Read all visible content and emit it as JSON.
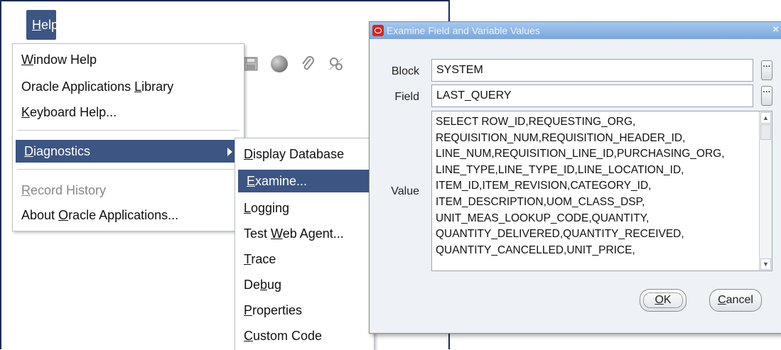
{
  "menubar": {
    "help": {
      "hotkey": "H",
      "rest": "elp"
    }
  },
  "help_menu": {
    "items": [
      {
        "hotkey": "W",
        "rest": "indow Help",
        "pre": ""
      },
      {
        "pre": "Oracle Applications ",
        "hotkey": "L",
        "rest": "ibrary"
      },
      {
        "pre": "",
        "hotkey": "K",
        "rest": "eyboard Help..."
      },
      {
        "pre": "",
        "hotkey": "D",
        "rest": "iagnostics"
      },
      {
        "pre": "",
        "hotkey": "R",
        "rest": "ecord History"
      },
      {
        "pre": "About ",
        "hotkey": "O",
        "rest": "racle Applications..."
      }
    ]
  },
  "diagnostics_menu": {
    "items": [
      {
        "pre": "",
        "hotkey": "D",
        "rest": "isplay Database"
      },
      {
        "pre": "",
        "hotkey": "E",
        "rest": "xamine..."
      },
      {
        "pre": "",
        "hotkey": "L",
        "rest": "ogging"
      },
      {
        "pre": "Test ",
        "hotkey": "W",
        "rest": "eb Agent..."
      },
      {
        "pre": "",
        "hotkey": "T",
        "rest": "race"
      },
      {
        "pre": "De",
        "hotkey": "b",
        "rest": "ug"
      },
      {
        "pre": "",
        "hotkey": "P",
        "rest": "roperties"
      },
      {
        "pre": "",
        "hotkey": "C",
        "rest": "ustom Code"
      }
    ]
  },
  "dialog": {
    "title": "Examine Field and Variable Values",
    "close": "×",
    "block_label": "Block",
    "block_value": "SYSTEM",
    "field_label": "Field",
    "field_value": "LAST_QUERY",
    "value_label": "Value",
    "value_lines": [
      "SELECT ROW_ID,REQUESTING_ORG,",
      "REQUISITION_NUM,REQUISITION_HEADER_ID,",
      "LINE_NUM,REQUISITION_LINE_ID,PURCHASING_ORG,",
      "LINE_TYPE,LINE_TYPE_ID,LINE_LOCATION_ID,",
      "ITEM_ID,ITEM_REVISION,CATEGORY_ID,",
      "ITEM_DESCRIPTION,UOM_CLASS_DSP,",
      "UNIT_MEAS_LOOKUP_CODE,QUANTITY,",
      "QUANTITY_DELIVERED,QUANTITY_RECEIVED,",
      "QUANTITY_CANCELLED,UNIT_PRICE,"
    ],
    "lov_glyph": "···",
    "ok": {
      "hotkey": "O",
      "rest": "K"
    },
    "cancel": {
      "hotkey": "C",
      "rest": "ancel"
    }
  },
  "colors": {
    "menu_highlight": "#3c5583",
    "titlebar": "#7aa6dc"
  },
  "icons": [
    "save-icon",
    "globe-icon",
    "attachment-icon",
    "folder-tools-icon"
  ]
}
